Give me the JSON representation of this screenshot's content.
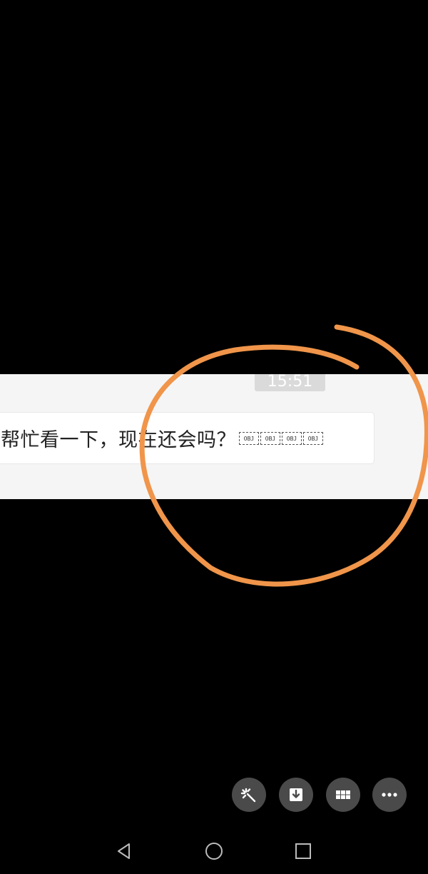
{
  "chat": {
    "timestamp": "15:51",
    "message": "帮忙看一下，现在还会吗？",
    "unknown_glyphs": [
      "OBJ",
      "OBJ",
      "OBJ",
      "OBJ"
    ]
  },
  "colors": {
    "background": "#000000",
    "chat_background": "#f5f5f5",
    "annotation_stroke": "#f0954a",
    "fab_background": "#4a4a4a"
  },
  "toolbar": {
    "buttons": [
      {
        "icon": "magic-wand-icon"
      },
      {
        "icon": "download-icon"
      },
      {
        "icon": "grid-icon"
      },
      {
        "icon": "more-icon"
      }
    ]
  },
  "navigation": {
    "buttons": [
      {
        "icon": "back-triangle-icon"
      },
      {
        "icon": "home-circle-icon"
      },
      {
        "icon": "recents-square-icon"
      }
    ]
  }
}
